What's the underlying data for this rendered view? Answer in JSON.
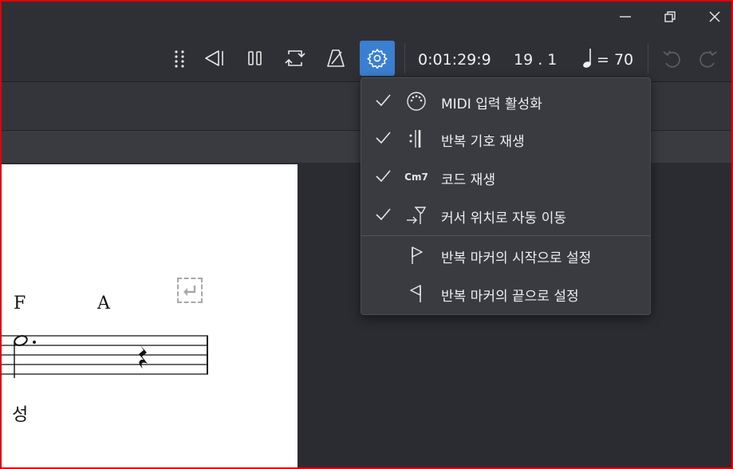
{
  "toolbar": {
    "time": "0:01:29:9",
    "position": "19 . 1",
    "tempo": "= 70"
  },
  "score": {
    "chords": [
      "F",
      "A"
    ],
    "lyric": "성"
  },
  "settings_menu": {
    "items": [
      {
        "label": "MIDI 입력 활성화",
        "checked": true,
        "icon": "midi-port-icon"
      },
      {
        "label": "반복 기호 재생",
        "checked": true,
        "icon": "repeat-barline-icon"
      },
      {
        "label": "코드 재생",
        "checked": true,
        "icon": "chord-symbol-icon",
        "icon_text": "Cm7"
      },
      {
        "label": "커서 위치로 자동 이동",
        "checked": true,
        "icon": "cursor-follow-icon"
      },
      {
        "label": "반복 마커의 시작으로 설정",
        "checked": false,
        "icon": "flag-start-icon"
      },
      {
        "label": "반복 마커의 끝으로 설정",
        "checked": false,
        "icon": "flag-end-icon"
      }
    ]
  },
  "colors": {
    "accent": "#3a7fd1",
    "frame": "#e0000a",
    "background": "#2b2c31",
    "menu": "#3a3b40"
  }
}
